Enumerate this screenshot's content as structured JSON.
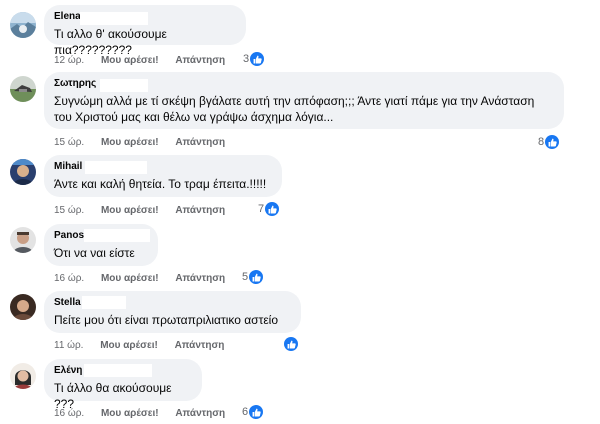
{
  "comments": [
    {
      "author": "Elena",
      "text": "Τι αλλο θ' ακούσουμε πια?????????",
      "time": "12 ώρ.",
      "like_label": "Μου αρέσει!",
      "reply_label": "Απάντηση",
      "reactions": "3"
    },
    {
      "author": "Σωτηρης",
      "text": "Συγνώμη αλλά με τί σκέψη βγάλατε αυτή την απόφαση;;; Άντε γιατί πάμε για την Ανάσταση\nτου Χριστού μας και θέλω να γράψω άσχημα λόγια...",
      "time": "15 ώρ.",
      "like_label": "Μου αρέσει!",
      "reply_label": "Απάντηση",
      "reactions": "8"
    },
    {
      "author": "Mihail",
      "text": "Άντε και καλή θητεία. Το τραμ έπειτα.!!!!!",
      "time": "15 ώρ.",
      "like_label": "Μου αρέσει!",
      "reply_label": "Απάντηση",
      "reactions": "7"
    },
    {
      "author": "Panos",
      "text": "Ότι να ναι είστε",
      "time": "16 ώρ.",
      "like_label": "Μου αρέσει!",
      "reply_label": "Απάντηση",
      "reactions": "5"
    },
    {
      "author": "Stella",
      "text": "Πείτε μου ότι είναι πρωταπριλιατικο αστείο",
      "time": "11 ώρ.",
      "like_label": "Μου αρέσει!",
      "reply_label": "Απάντηση",
      "reactions": ""
    },
    {
      "author": "Ελένη",
      "text": "Τι άλλο θα ακούσουμε ???",
      "time": "16 ώρ.",
      "like_label": "Μου αρέσει!",
      "reply_label": "Απάντηση",
      "reactions": "6"
    }
  ],
  "colors": {
    "bubble": "#f0f2f5",
    "like_badge": "#1877f2",
    "meta_text": "#65676b",
    "text": "#050505"
  },
  "icons": {
    "reaction": "thumbs-up-icon"
  }
}
